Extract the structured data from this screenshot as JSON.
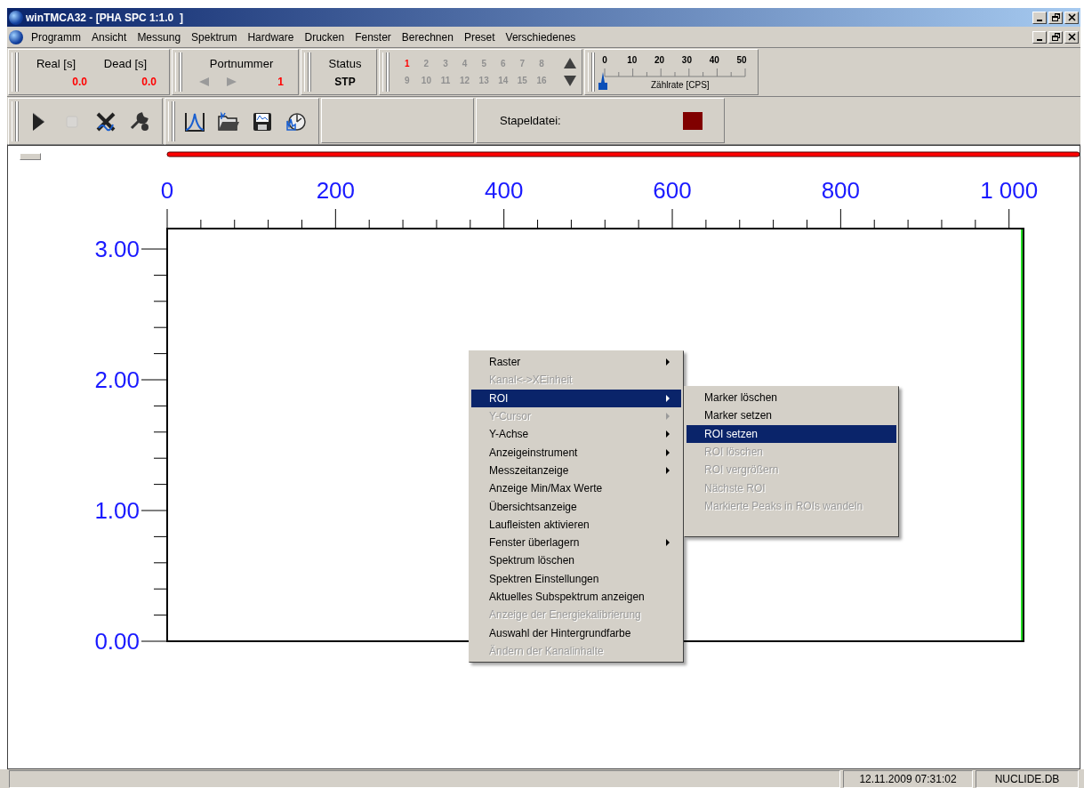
{
  "window": {
    "title": "winTMCA32 - [PHA SPC 1:1.0  ]"
  },
  "menu": [
    "Programm",
    "Ansicht",
    "Messung",
    "Spektrum",
    "Hardware",
    "Drucken",
    "Fenster",
    "Berechnen",
    "Preset",
    "Verschiedenes"
  ],
  "times": {
    "real_label": "Real [s]",
    "real_value": "0.0",
    "dead_label": "Dead [s]",
    "dead_value": "0.0"
  },
  "port": {
    "label": "Portnummer",
    "value": "1",
    "nav_disabled": true
  },
  "status": {
    "label": "Status",
    "value": "STP"
  },
  "ports": [
    {
      "label": "1",
      "selected": true
    },
    {
      "label": "2",
      "selected": false
    },
    {
      "label": "3",
      "selected": false
    },
    {
      "label": "4",
      "selected": false
    },
    {
      "label": "5",
      "selected": false
    },
    {
      "label": "6",
      "selected": false
    },
    {
      "label": "7",
      "selected": false
    },
    {
      "label": "8",
      "selected": false
    },
    {
      "label": "9",
      "selected": false
    },
    {
      "label": "10",
      "selected": false
    },
    {
      "label": "11",
      "selected": false
    },
    {
      "label": "12",
      "selected": false
    },
    {
      "label": "13",
      "selected": false
    },
    {
      "label": "14",
      "selected": false
    },
    {
      "label": "15",
      "selected": false
    },
    {
      "label": "16",
      "selected": false
    }
  ],
  "gauge": {
    "scale": [
      "0",
      "10",
      "20",
      "30",
      "40",
      "50"
    ],
    "label": "Zählrate [CPS]"
  },
  "toolbar": [
    [
      {
        "kind": "play",
        "disabled": false
      },
      {
        "kind": "stop",
        "disabled": true
      },
      {
        "kind": "cross",
        "disabled": false
      },
      {
        "kind": "tools",
        "disabled": false
      }
    ],
    [
      {
        "kind": "peak",
        "disabled": false
      },
      {
        "kind": "open",
        "disabled": false
      },
      {
        "kind": "save",
        "disabled": false
      },
      {
        "kind": "clock",
        "disabled": false
      }
    ]
  ],
  "batch": {
    "label": "Stapeldatei:"
  },
  "plot": {
    "x_labels": [
      "0",
      "200",
      "400",
      "600",
      "800",
      "1 000"
    ],
    "y_labels": [
      "3.00",
      "2.00",
      "1.00",
      "0.00"
    ]
  },
  "context_menu": [
    {
      "label": "Raster",
      "disabled": false,
      "selected": false,
      "submenu": true
    },
    {
      "label": "Kanal<->XEinheit",
      "disabled": true,
      "selected": false,
      "submenu": false
    },
    {
      "label": "ROI",
      "disabled": false,
      "selected": true,
      "submenu": true
    },
    {
      "label": "Y-Cursor",
      "disabled": true,
      "selected": false,
      "submenu": true
    },
    {
      "label": "Y-Achse",
      "disabled": false,
      "selected": false,
      "submenu": true
    },
    {
      "label": "Anzeigeinstrument",
      "disabled": false,
      "selected": false,
      "submenu": true
    },
    {
      "label": "Messzeitanzeige",
      "disabled": false,
      "selected": false,
      "submenu": true
    },
    {
      "label": "Anzeige Min/Max Werte",
      "disabled": false,
      "selected": false,
      "submenu": false
    },
    {
      "label": "Übersichtsanzeige",
      "disabled": false,
      "selected": false,
      "submenu": false
    },
    {
      "label": "Laufleisten aktivieren",
      "disabled": false,
      "selected": false,
      "submenu": false
    },
    {
      "label": "Fenster überlagern",
      "disabled": false,
      "selected": false,
      "submenu": true
    },
    {
      "label": "Spektrum löschen",
      "disabled": false,
      "selected": false,
      "submenu": false
    },
    {
      "label": "Spektren Einstellungen",
      "disabled": false,
      "selected": false,
      "submenu": false
    },
    {
      "label": "Aktuelles Subspektrum anzeigen",
      "disabled": false,
      "selected": false,
      "submenu": false
    },
    {
      "label": "Anzeige der Energiekalibrierung",
      "disabled": true,
      "selected": false,
      "submenu": false
    },
    {
      "label": "Auswahl der Hintergrundfarbe",
      "disabled": false,
      "selected": false,
      "submenu": false
    },
    {
      "label": "Ändern der Kanalinhalte",
      "disabled": true,
      "selected": false,
      "submenu": false
    }
  ],
  "submenu": [
    {
      "label": "Marker löschen",
      "disabled": false,
      "selected": false
    },
    {
      "label": "Marker setzen",
      "disabled": false,
      "selected": false
    },
    {
      "label": "ROI setzen",
      "disabled": false,
      "selected": true
    },
    {
      "label": "ROI löschen",
      "disabled": true,
      "selected": false
    },
    {
      "label": "ROI vergrößern",
      "disabled": true,
      "selected": false
    },
    {
      "label": "Nächste ROI",
      "disabled": true,
      "selected": false
    },
    {
      "label": "Markierte Peaks in ROIs wandeln",
      "disabled": true,
      "selected": false
    }
  ],
  "status_bar": [
    "12.11.2009 07:31:02",
    "NUCLIDE.DB"
  ]
}
